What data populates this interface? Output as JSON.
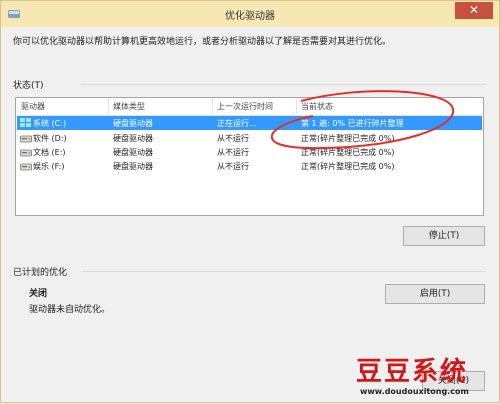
{
  "window": {
    "title": "优化驱动器",
    "close_glyph": "✕"
  },
  "intro": "你可以优化驱动器以帮助计算机更高效地运行，或者分析驱动器以了解是否需要对其进行优化。",
  "status_section": {
    "label": "状态(T)"
  },
  "table": {
    "headers": [
      "驱动器",
      "媒体类型",
      "上一次运行时间",
      "当前状态"
    ],
    "rows": [
      {
        "drive": "系统 (C:)",
        "media": "硬盘驱动器",
        "last_run": "正在运行...",
        "status": "第 1 遍: 0% 已进行碎片整理",
        "selected": true,
        "icon": "windows-drive-icon"
      },
      {
        "drive": "软件 (D:)",
        "media": "硬盘驱动器",
        "last_run": "从不运行",
        "status": "正常(碎片整理已完成 0%)",
        "selected": false,
        "icon": "hard-drive-icon"
      },
      {
        "drive": "文档 (E:)",
        "media": "硬盘驱动器",
        "last_run": "从不运行",
        "status": "正常(碎片整理已完成 0%)",
        "selected": false,
        "icon": "hard-drive-icon"
      },
      {
        "drive": "娱乐 (F:)",
        "media": "硬盘驱动器",
        "last_run": "从不运行",
        "status": "正常(碎片整理已完成 0%)",
        "selected": false,
        "icon": "hard-drive-icon"
      }
    ]
  },
  "buttons": {
    "stop": "停止(T)",
    "enable": "启用(T)",
    "close": "关闭(C)"
  },
  "scheduled": {
    "label": "已计划的优化",
    "state": "关闭",
    "description": "驱动器未自动优化。"
  },
  "watermark": {
    "text": "豆豆系统",
    "url": "www.doudouxitong.com"
  },
  "colors": {
    "selection": "#3399ff",
    "annotation": "#e0302a",
    "titlebar": "#f7e7b3",
    "close": "#c7503f"
  }
}
